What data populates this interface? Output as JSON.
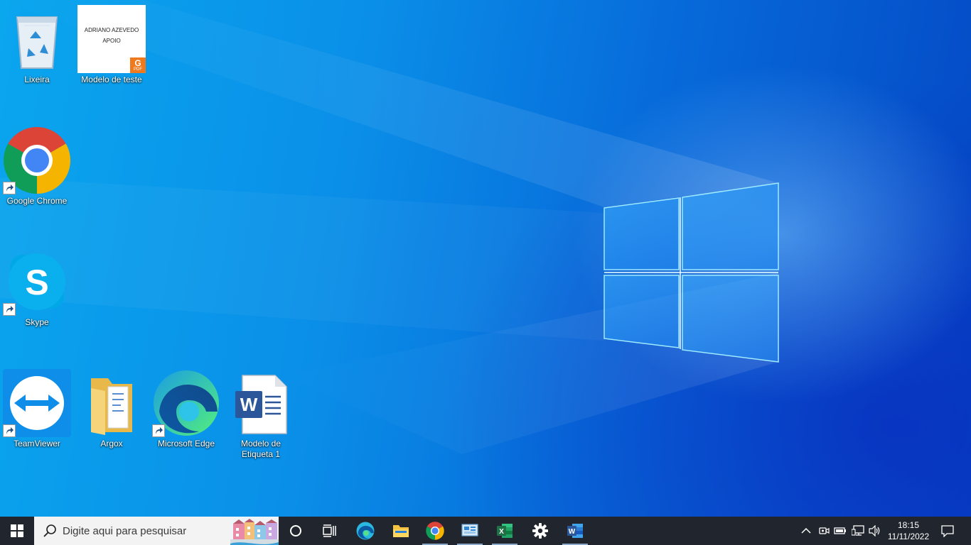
{
  "desktop": {
    "icons": [
      {
        "label": "Lixeira",
        "icon": "recycle-bin-icon"
      },
      {
        "label": "Modelo de teste",
        "icon": "pdf-document-icon",
        "thumbnail_lines": [
          "ADRIANO AZEVEDO",
          "APOIO"
        ],
        "badge_text": "PDF"
      },
      {
        "label": "Google Chrome",
        "icon": "chrome-icon"
      },
      {
        "label": "Skype",
        "icon": "skype-icon"
      },
      {
        "label": "TeamViewer",
        "icon": "teamviewer-icon"
      },
      {
        "label": "Argox",
        "icon": "folder-icon"
      },
      {
        "label": "Microsoft Edge",
        "icon": "edge-icon"
      },
      {
        "label": "Modelo de Etiqueta 1",
        "icon": "word-document-icon"
      }
    ]
  },
  "taskbar": {
    "search_placeholder": "Digite aqui para pesquisar",
    "pinned_apps": [
      "start",
      "cortana",
      "task-view",
      "edge",
      "file-explorer",
      "chrome",
      "control-panel",
      "excel",
      "settings",
      "word"
    ],
    "tray_icons": [
      "show-hidden-icons",
      "meet-now",
      "battery",
      "network",
      "volume"
    ],
    "clock": {
      "time": "18:15",
      "date": "11/11/2022"
    }
  },
  "colors": {
    "taskbar": "#21262e",
    "wallpaper_light": "#0aa6ee",
    "wallpaper_dark": "#0447c4",
    "chrome_red": "#db4437",
    "chrome_yellow": "#f4b400",
    "chrome_green": "#0f9d58",
    "chrome_blue": "#4285f4",
    "word_blue": "#2b579a",
    "excel_green": "#1e7145"
  }
}
